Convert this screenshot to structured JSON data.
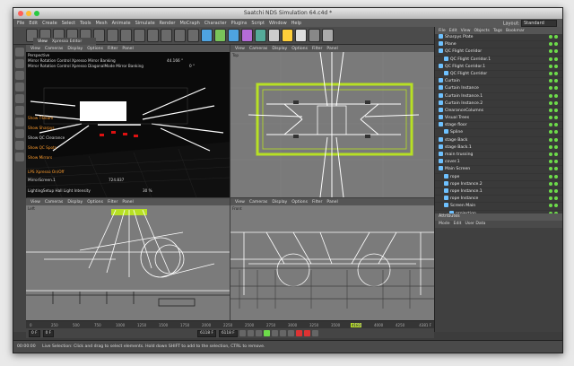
{
  "window": {
    "title": "Saatchi NDS Simulation 64.c4d *"
  },
  "menu": [
    "File",
    "Edit",
    "Create",
    "Select",
    "Tools",
    "Mesh",
    "Animate",
    "Simulate",
    "Render",
    "MoCraph",
    "Character",
    "Plugins",
    "Script",
    "Window",
    "Help"
  ],
  "layout": {
    "label": "Layout:",
    "value": "Standard"
  },
  "vp_perspective": {
    "tabs": [
      "View",
      "Cameras",
      "Display",
      "Options",
      "Filter",
      "Panel"
    ],
    "panel_tab": "View",
    "panel_tab2": "Xpresso Editor",
    "name": "Perspective",
    "sliders": [
      {
        "label": "Mirror Rotation Control Xpresso Mirror Banking",
        "value": "44.166 °"
      },
      {
        "label": "Mirror Rotation Control Xpresso DiagonalMode Mirror Banking",
        "value": "0 °"
      }
    ],
    "toggles": [
      "Show T-Beam",
      "Show Sharpys",
      "Show QC Clearance",
      "Show QC Spots",
      "Show Mirrors"
    ],
    "toggle_colors": [
      "#ff9d2e",
      "#ff9d2e",
      "#dddddd",
      "#ff9d2e",
      "#ff9d2e"
    ],
    "lps": "LPS Xpresso On/Off",
    "mirror": {
      "label": "MirrorScreen.1",
      "value": "724.837"
    },
    "light": {
      "label": "LightingSetup Hall Light Intensity",
      "value": "30 %"
    }
  },
  "vp_top": {
    "tabs": [
      "View",
      "Cameras",
      "Display",
      "Options",
      "Filter",
      "Panel"
    ],
    "name": "Top"
  },
  "vp_left": {
    "tabs": [
      "View",
      "Cameras",
      "Display",
      "Options",
      "Filter",
      "Panel"
    ],
    "name": "Left"
  },
  "vp_front": {
    "tabs": [
      "View",
      "Cameras",
      "Display",
      "Options",
      "Filter",
      "Panel"
    ],
    "name": "Front"
  },
  "objects": {
    "menu": [
      "File",
      "Edit",
      "View",
      "Objects",
      "Tags",
      "Bookmar"
    ],
    "rows": [
      {
        "name": "Sharpys Plate",
        "indent": 0
      },
      {
        "name": "Plane",
        "indent": 0
      },
      {
        "name": "QC Flight Corridor",
        "indent": 0
      },
      {
        "name": "QC Flight Corridor.1",
        "indent": 1
      },
      {
        "name": "QC Flight Corridor.1",
        "indent": 0
      },
      {
        "name": "QC Flight Corridor",
        "indent": 1
      },
      {
        "name": "Curtain",
        "indent": 0
      },
      {
        "name": "Curtain Instance",
        "indent": 0
      },
      {
        "name": "Curtain Instance.1",
        "indent": 0
      },
      {
        "name": "Curtain Instance.2",
        "indent": 0
      },
      {
        "name": "ClearanceColumns",
        "indent": 0
      },
      {
        "name": "Visual Trees",
        "indent": 0
      },
      {
        "name": "stage floor",
        "indent": 0
      },
      {
        "name": "Spline",
        "indent": 1
      },
      {
        "name": "stage Back",
        "indent": 0
      },
      {
        "name": "stage Back.1",
        "indent": 0
      },
      {
        "name": "main trussing",
        "indent": 0
      },
      {
        "name": "cover.1",
        "indent": 0
      },
      {
        "name": "Main Screen",
        "indent": 0
      },
      {
        "name": "rope",
        "indent": 1
      },
      {
        "name": "rope Instance.2",
        "indent": 1
      },
      {
        "name": "rope Instance.1",
        "indent": 1
      },
      {
        "name": "rope Instance",
        "indent": 1
      },
      {
        "name": "Screen Main",
        "indent": 1
      },
      {
        "name": "projection",
        "indent": 2
      }
    ]
  },
  "attributes": {
    "title": "Attributes",
    "menu": [
      "Mode",
      "Edit",
      "User Data"
    ]
  },
  "timeline": {
    "ticks": [
      "0",
      "250",
      "500",
      "750",
      "1000",
      "1250",
      "1500",
      "1750",
      "2000",
      "2250",
      "2500",
      "2750",
      "3000",
      "3250",
      "3500",
      "3750",
      "4000",
      "4250"
    ],
    "end": "4381 F",
    "marker": "4183"
  },
  "controls": {
    "start": "0 F",
    "current": "0 F",
    "end": "6118 F",
    "fps": "6118 F"
  },
  "status": {
    "time": "00:00:00",
    "text": "Live Selection: Click and drag to select elements. Hold down SHIFT to add to the selection, CTRL to remove."
  },
  "colors": {
    "accent_green": "#b7e024",
    "accent_orange": "#ff9d2e",
    "panel": "#3c3c3c"
  }
}
